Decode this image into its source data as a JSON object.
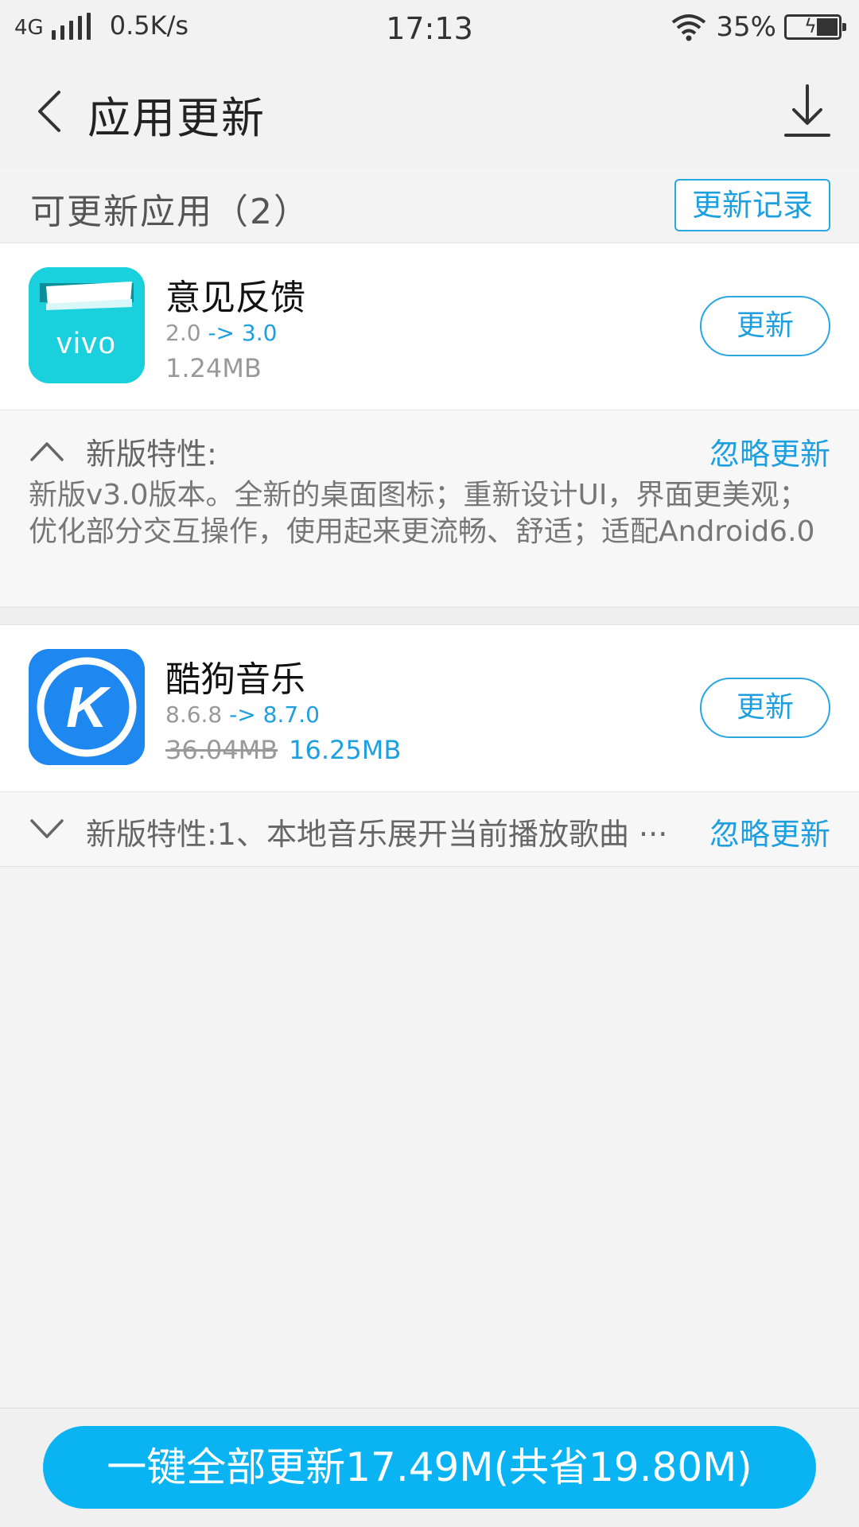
{
  "status_bar": {
    "network": "4G",
    "speed": "0.5K/s",
    "time": "17:13",
    "battery": "35%"
  },
  "header": {
    "title": "应用更新"
  },
  "section": {
    "title": "可更新应用（2）",
    "history_button": "更新记录"
  },
  "apps": [
    {
      "name": "意见反馈",
      "version_old": "2.0",
      "version_arrow": "->",
      "version_new": "3.0",
      "size": "1.24MB",
      "icon_text": "vivo",
      "update_label": "更新",
      "notes_label": "新版特性:",
      "ignore_label": "忽略更新",
      "notes_body": "新版v3.0版本。全新的桌面图标；重新设计UI，界面更美观；优化部分交互操作，使用起来更流畅、舒适；适配Android6.0",
      "expanded": true
    },
    {
      "name": "酷狗音乐",
      "version_old": "8.6.8",
      "version_arrow": "->",
      "version_new": "8.7.0",
      "size_old": "36.04MB",
      "size_new": "16.25MB",
      "icon_text": "K",
      "update_label": "更新",
      "notes_label": "新版特性:1、本地音乐展开当前播放歌曲 ···",
      "ignore_label": "忽略更新",
      "expanded": false
    }
  ],
  "footer": {
    "update_all_label": "一键全部更新17.49M(共省19.80M)"
  },
  "colors": {
    "accent": "#1e9fe0",
    "primary_button": "#0ab4f2",
    "vivo_icon": "#1ad0dc",
    "kugou_icon": "#1e88f0"
  }
}
